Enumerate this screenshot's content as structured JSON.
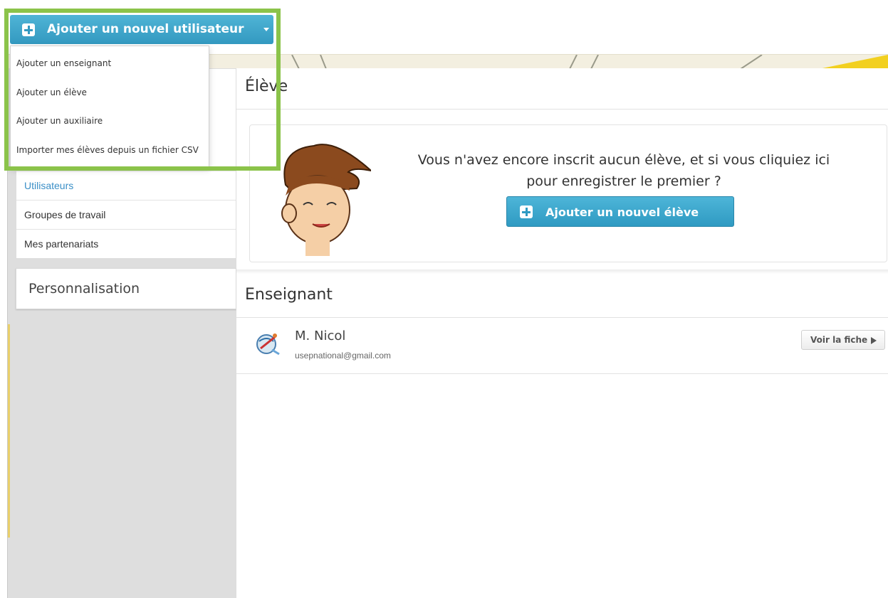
{
  "top": {
    "add_user_label": "Ajouter un nouvel utilisateur",
    "dropdown": [
      {
        "label": "Ajouter un enseignant"
      },
      {
        "label": "Ajouter un élève"
      },
      {
        "label": "Ajouter un auxiliaire"
      },
      {
        "label": "Importer mes élèves depuis un fichier CSV"
      }
    ]
  },
  "sidebar": {
    "items": [
      {
        "label": "Utilisateurs",
        "active": true
      },
      {
        "label": "Groupes de travail"
      },
      {
        "label": "Mes partenariats"
      }
    ],
    "customization_label": "Personnalisation"
  },
  "main": {
    "student_section": {
      "title": "Élève",
      "empty_line1": "Vous n'avez encore inscrit aucun élève, et si vous cliquiez ici",
      "empty_line2": "pour enregistrer le premier ?",
      "add_button_label": "Ajouter un nouvel élève"
    },
    "teacher_section": {
      "title": "Enseignant",
      "teachers": [
        {
          "name": "M. Nicol",
          "email": "usepnational@gmail.com",
          "view_label": "Voir la fiche"
        }
      ]
    }
  },
  "colors": {
    "accent_blue": "#3399c0",
    "highlight_green": "#8bc34a",
    "active_link": "#3a8fc7"
  }
}
